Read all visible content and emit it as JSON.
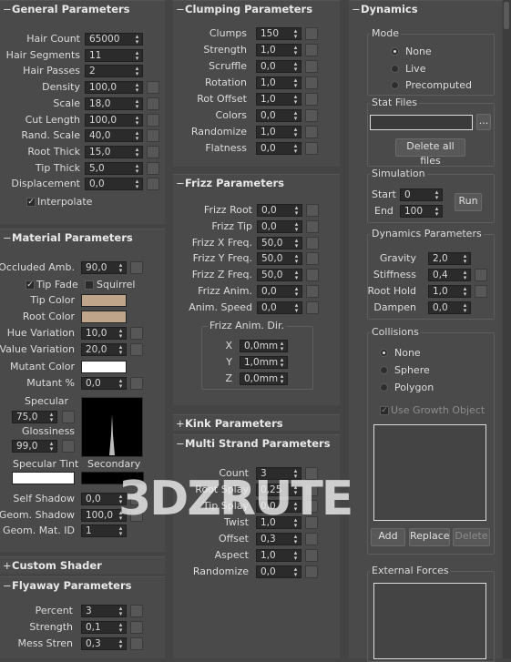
{
  "general": {
    "title": "General Parameters",
    "rows": [
      {
        "label": "Hair Count",
        "value": "65000"
      },
      {
        "label": "Hair Segments",
        "value": "11"
      },
      {
        "label": "Hair Passes",
        "value": "2"
      },
      {
        "label": "Density",
        "value": "100,0"
      },
      {
        "label": "Scale",
        "value": "18,0"
      },
      {
        "label": "Cut Length",
        "value": "100,0"
      },
      {
        "label": "Rand. Scale",
        "value": "40,0"
      },
      {
        "label": "Root Thick",
        "value": "15,0"
      },
      {
        "label": "Tip Thick",
        "value": "5,0"
      },
      {
        "label": "Displacement",
        "value": "0,0"
      }
    ],
    "interpolate": "Interpolate"
  },
  "material": {
    "title": "Material Parameters",
    "occluded_label": "Occluded Amb.",
    "occluded_value": "90,0",
    "tip_fade": "Tip Fade",
    "squirrel": "Squirrel",
    "tip_color": "Tip Color",
    "root_color": "Root Color",
    "hue_label": "Hue Variation",
    "hue_value": "10,0",
    "value_label": "Value Variation",
    "value_value": "20,0",
    "mutant_color": "Mutant Color",
    "mutant_pct_label": "Mutant %",
    "mutant_pct_value": "0,0",
    "specular": "Specular",
    "specular_value": "75,0",
    "glossiness": "Glossiness",
    "glossiness_value": "99,0",
    "specular_tint": "Specular Tint",
    "secondary": "Secondary",
    "self_shadow_label": "Self Shadow",
    "self_shadow_value": "0,0",
    "geom_shadow_label": "Geom. Shadow",
    "geom_shadow_value": "100,0",
    "geom_mat_label": "Geom. Mat. ID",
    "geom_mat_value": "1",
    "colors": {
      "tip": "#bfa58a",
      "root": "#bfa58a",
      "mutant": "#ffffff",
      "spec_tint": "#ffffff",
      "secondary": "#000000"
    }
  },
  "custom_shader": {
    "title": "Custom Shader"
  },
  "flyaway": {
    "title": "Flyaway Parameters",
    "rows": [
      {
        "label": "Percent",
        "value": "3"
      },
      {
        "label": "Strength",
        "value": "0,1"
      },
      {
        "label": "Mess Stren",
        "value": "0,3"
      }
    ]
  },
  "clumping": {
    "title": "Clumping Parameters",
    "rows": [
      {
        "label": "Clumps",
        "value": "150"
      },
      {
        "label": "Strength",
        "value": "1,0"
      },
      {
        "label": "Scruffle",
        "value": "0,0"
      },
      {
        "label": "Rotation",
        "value": "1,0"
      },
      {
        "label": "Rot Offset",
        "value": "1,0"
      },
      {
        "label": "Colors",
        "value": "0,0"
      },
      {
        "label": "Randomize",
        "value": "1,0"
      },
      {
        "label": "Flatness",
        "value": "0,0"
      }
    ]
  },
  "frizz": {
    "title": "Frizz Parameters",
    "rows": [
      {
        "label": "Frizz Root",
        "value": "0,0"
      },
      {
        "label": "Frizz Tip",
        "value": "0,0"
      },
      {
        "label": "Frizz X Freq.",
        "value": "50,0"
      },
      {
        "label": "Frizz Y Freq.",
        "value": "50,0"
      },
      {
        "label": "Frizz Z Freq.",
        "value": "50,0"
      },
      {
        "label": "Frizz Anim.",
        "value": "0,0"
      },
      {
        "label": "Anim. Speed",
        "value": "0,0"
      }
    ],
    "dir_title": "Frizz Anim. Dir.",
    "dir": [
      {
        "label": "X",
        "value": "0,0mm"
      },
      {
        "label": "Y",
        "value": "1,0mm"
      },
      {
        "label": "Z",
        "value": "0,0mm"
      }
    ]
  },
  "kink": {
    "title": "Kink Parameters"
  },
  "multistrand": {
    "title": "Multi Strand Parameters",
    "rows": [
      {
        "label": "Count",
        "value": "3"
      },
      {
        "label": "Root Splay",
        "value": "0,25"
      },
      {
        "label": "Tip Splay",
        "value": "0,0"
      },
      {
        "label": "Twist",
        "value": "1,0"
      },
      {
        "label": "Offset",
        "value": "0,3"
      },
      {
        "label": "Aspect",
        "value": "1,0"
      },
      {
        "label": "Randomize",
        "value": "0,0"
      }
    ]
  },
  "dynamics": {
    "title": "Dynamics",
    "mode_title": "Mode",
    "modes": [
      "None",
      "Live",
      "Precomputed"
    ],
    "stat_title": "Stat Files",
    "browse": "...",
    "delete_all": "Delete all files",
    "sim_title": "Simulation",
    "start_label": "Start",
    "start_value": "0",
    "end_label": "End",
    "end_value": "100",
    "run": "Run",
    "dyn_params_title": "Dynamics Parameters",
    "params": [
      {
        "label": "Gravity",
        "value": "2,0"
      },
      {
        "label": "Stiffness",
        "value": "0,4"
      },
      {
        "label": "Root Hold",
        "value": "1,0"
      },
      {
        "label": "Dampen",
        "value": "0,0"
      }
    ],
    "collisions_title": "Collisions",
    "collisions": [
      "None",
      "Sphere",
      "Polygon"
    ],
    "use_growth": "Use Growth Object",
    "add": "Add",
    "replace": "Replace",
    "delete": "Delete",
    "external_title": "External Forces"
  },
  "watermark": "3DZRUTE"
}
